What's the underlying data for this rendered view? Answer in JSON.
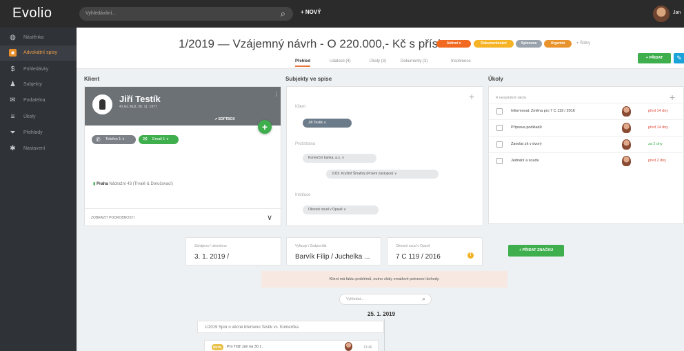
{
  "app": {
    "logo": "Evolio",
    "search_placeholder": "Vyhledávání...",
    "new_label": "+ NOVÝ",
    "user": "Jan"
  },
  "sidebar": {
    "items": [
      {
        "label": "Nástěnka",
        "icon": "globe-icon",
        "glyph": "◍"
      },
      {
        "label": "Advokátní spisy",
        "icon": "briefcase-icon",
        "glyph": "■",
        "active": true
      },
      {
        "label": "Pohledávky",
        "icon": "dollar-icon",
        "glyph": "$"
      },
      {
        "label": "Subjekty",
        "icon": "person-icon",
        "glyph": "♟"
      },
      {
        "label": "Podatelna",
        "icon": "mail-icon",
        "glyph": "✉"
      },
      {
        "label": "Úkoly",
        "icon": "list-icon",
        "glyph": "≡"
      },
      {
        "label": "Přehledy",
        "icon": "filter-icon",
        "glyph": "⏷"
      },
      {
        "label": "Nastavení",
        "icon": "gear-icon",
        "glyph": "✱"
      }
    ]
  },
  "header": {
    "title": "1/2019 — Vzájemný návrh - O 220.000,- Kč s přísl.",
    "badges": [
      {
        "label": "Aktivní ▾",
        "color": "#f26a21"
      },
      {
        "label": "Dokumentování",
        "color": "#f5b325"
      },
      {
        "label": "Spisovna",
        "color": "#9aa3ab"
      },
      {
        "label": "Urgentní",
        "color": "#e9932c"
      }
    ],
    "stitky": "+ Štítky",
    "tabs": [
      "Přehled",
      "Události (4)",
      "Úkoly (3)",
      "Dokumenty (3)",
      "Insolvence"
    ],
    "add_button": "+ PŘIDAT",
    "edit_icon": "✎"
  },
  "klient": {
    "section": "Klient",
    "name": "Jiří Testík",
    "sub": "41 let, Muž, 30. 11. 1977",
    "menu": "⋮",
    "softbox": "↗ SOFTBOX",
    "phone_pill": "Telefon 1 ∨",
    "email_pill": "Email 1 ∨",
    "address_city": "Praha",
    "address_rest": "Nádražní 43 (Trvalé & Doručovací)",
    "footer": "ZOBRAZIT PODROBNOSTI",
    "chevron": "∨"
  },
  "subjekty": {
    "section": "Subjekty ve spise",
    "klient_label": "Klient",
    "klient_value": "Jiří Testík  ∨",
    "protistrana_label": "Protistrana",
    "protistrana_value": "Komerční banka, a.s.  ∨",
    "zastupce_value": "JUDr. Kryštof Šmaltný (Právní zástupce)  ∨",
    "instituce_label": "Instituce",
    "instituce_value": "Okresní soud v Opavě  ∨"
  },
  "ukoly": {
    "section": "Úkoly",
    "top": "4 nesplněné úkoly",
    "rows": [
      {
        "text": "Informovat: Změna pro 7 C 119 / 2016",
        "deadline": "před 14 dny",
        "color": "#e04b3a"
      },
      {
        "text": "Příprava podkladů",
        "deadline": "před 14 dny",
        "color": "#e04b3a"
      },
      {
        "text": "Zavolat zít v dvorý",
        "deadline": "za 2 dny",
        "color": "#3fae4c"
      },
      {
        "text": "Jednání a soudu",
        "deadline": "před 2 dny",
        "color": "#e04b3a"
      }
    ]
  },
  "info": {
    "zahajeno_label": "Zahájeno / ukončeno",
    "zahajeno_value": "3. 1. 2019 /",
    "vyrizuje_label": "Vyřizuje / Zodpovídá",
    "vyrizuje_value": "Barvík Filip / Juchelka ...",
    "soud_label": "Okresní soud v Opavě",
    "soud_value": "7 C 119 / 2016",
    "warn": "!",
    "znacka_button": "+ PŘIDAT ZNAČKU"
  },
  "note": "Klient má faktu problémů, nutno všaly emailové potvrzení dohody.",
  "timeline": {
    "search_placeholder": "Vyhledat...",
    "date": "25. 1. 2019",
    "head": "1/2019 Spor o věcné břemeno Testík vs. Komerčka",
    "item_tag": "ÚKOL",
    "item_text": "Pro Tidž Jan na 30.1.",
    "item_time": "13:46"
  }
}
